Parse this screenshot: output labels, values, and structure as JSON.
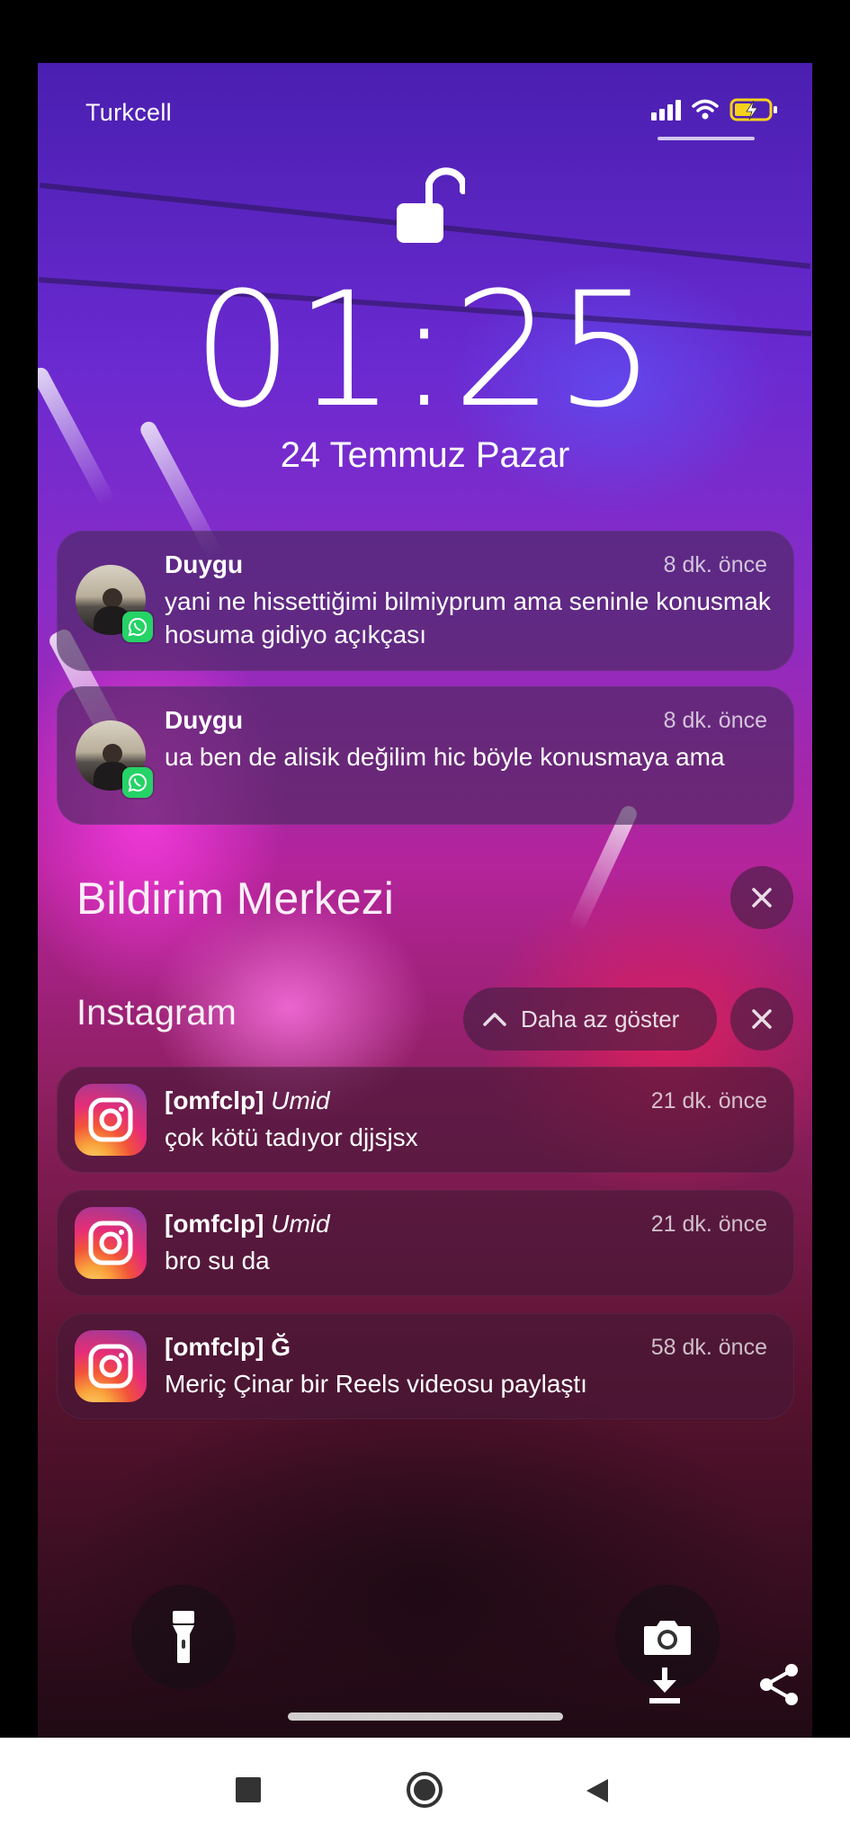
{
  "status": {
    "carrier": "Turkcell"
  },
  "lock": {
    "time": "01:25",
    "date": "24 Temmuz Pazar"
  },
  "notifications_top": [
    {
      "app": "whatsapp",
      "sender": "Duygu",
      "time": "8 dk. önce",
      "text": "yani ne hissettiğimi bilmiyprum ama seninle konusmak hosuma gidiyo açıkçası"
    },
    {
      "app": "whatsapp",
      "sender": "Duygu",
      "time": "8 dk. önce",
      "text": "ua ben de alisik değilim hic böyle konusmaya ama"
    }
  ],
  "notification_center": {
    "title": "Bildirim Merkezi"
  },
  "instagram_group": {
    "title": "Instagram",
    "show_less_label": "Daha az göster",
    "items": [
      {
        "account": "[omfclp]",
        "sub": "Umid",
        "time": "21 dk. önce",
        "text": "çok kötü tadıyor djjsjsx"
      },
      {
        "account": "[omfclp]",
        "sub": "Umid",
        "time": "21 dk. önce",
        "text": "bro su da"
      },
      {
        "account": "[omfclp] Ğ",
        "sub": "",
        "time": "58 dk. önce",
        "text": "Meriç Çinar bir Reels videosu paylaştı"
      }
    ]
  },
  "colors": {
    "whatsapp": "#25D366",
    "battery_fill": "#F7D21C"
  }
}
